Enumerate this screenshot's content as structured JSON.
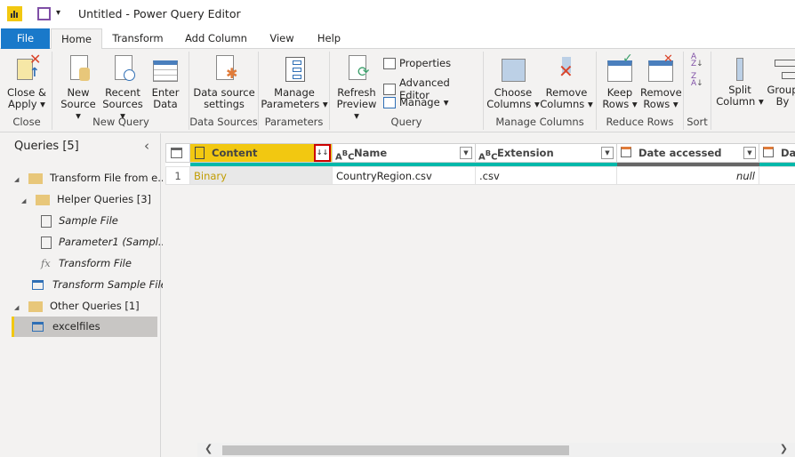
{
  "title": "Untitled - Power Query Editor",
  "tabs": [
    "File",
    "Home",
    "Transform",
    "Add Column",
    "View",
    "Help"
  ],
  "ribbon": {
    "groups": [
      "Close",
      "New Query",
      "Data Sources",
      "Parameters",
      "Query",
      "Manage Columns",
      "Reduce Rows",
      "Sort"
    ],
    "close_apply": [
      "Close &",
      "Apply"
    ],
    "new_source": [
      "New",
      "Source"
    ],
    "recent_sources": [
      "Recent",
      "Sources"
    ],
    "enter_data": [
      "Enter",
      "Data"
    ],
    "data_source_settings": [
      "Data source",
      "settings"
    ],
    "manage_parameters": [
      "Manage",
      "Parameters"
    ],
    "refresh_preview": [
      "Refresh",
      "Preview"
    ],
    "properties": "Properties",
    "advanced_editor": "Advanced Editor",
    "manage": "Manage",
    "choose_columns": [
      "Choose",
      "Columns"
    ],
    "remove_columns": [
      "Remove",
      "Columns"
    ],
    "keep_rows": [
      "Keep",
      "Rows"
    ],
    "remove_rows": [
      "Remove",
      "Rows"
    ],
    "split_column": [
      "Split",
      "Column"
    ],
    "group_by": [
      "Group",
      "By"
    ]
  },
  "queries": {
    "header": "Queries [5]",
    "items": [
      "Transform File from e...",
      "Helper Queries [3]",
      "Sample File",
      "Parameter1 (Sampl...",
      "Transform File",
      "Transform Sample File",
      "Other Queries [1]",
      "excelfiles"
    ]
  },
  "grid": {
    "columns": [
      "Content",
      "Name",
      "Extension",
      "Date accessed",
      "Da"
    ],
    "rows": [
      {
        "n": "1",
        "content": "Binary",
        "name": "CountryRegion.csv",
        "extension": ".csv",
        "date_accessed": "null"
      }
    ]
  },
  "colors": {
    "accent": "#f2c811",
    "file_tab": "#1979ca",
    "quality_bar": "#01b8aa"
  }
}
